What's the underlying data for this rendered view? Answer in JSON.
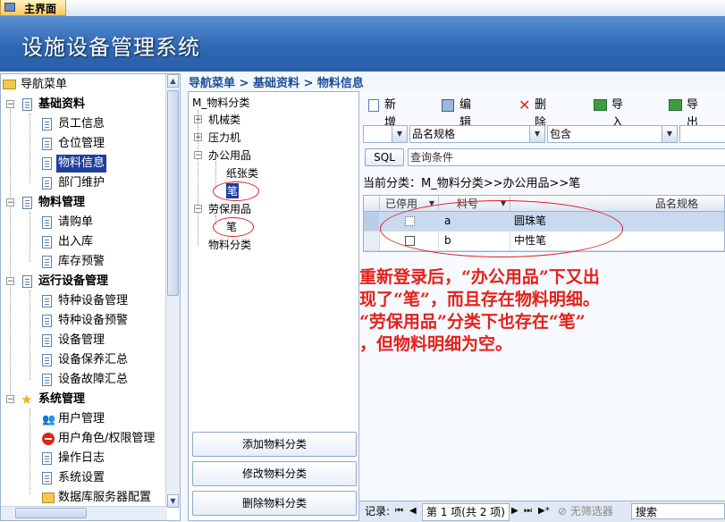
{
  "tab": {
    "label": "主界面"
  },
  "header": {
    "title": "设施设备管理系统"
  },
  "nav": {
    "root": "导航菜单",
    "groups": [
      {
        "label": "基础资料",
        "items": [
          "员工信息",
          "仓位管理",
          "物料信息",
          "部门维护"
        ]
      },
      {
        "label": "物料管理",
        "items": [
          "请购单",
          "出入库",
          "库存预警"
        ]
      },
      {
        "label": "运行设备管理",
        "items": [
          "特种设备管理",
          "特种设备预警",
          "设备管理",
          "设备保养汇总",
          "设备故障汇总"
        ]
      },
      {
        "label": "系统管理",
        "items": [
          "用户管理",
          "用户角色/权限管理",
          "操作日志",
          "系统设置",
          "数据库服务器配置"
        ]
      }
    ]
  },
  "breadcrumb": "导航菜单 > 基础资料 > 物料信息",
  "tree": {
    "root": "M_物料分类",
    "nodes": [
      "机械类",
      "压力机",
      "办公用品",
      "纸张类",
      "笔",
      "劳保用品",
      "笔",
      "物料分类"
    ]
  },
  "buttons": {
    "add": "添加物料分类",
    "edit": "修改物料分类",
    "del": "删除物料分类"
  },
  "toolbar": {
    "new": "新增",
    "edit": "编辑",
    "delete": "删除",
    "import": "导入",
    "export": "导出"
  },
  "filter": {
    "field": "品名规格",
    "op": "包含",
    "sql": "SQL",
    "query_placeholder": "查询条件"
  },
  "current_category": "当前分类：M_物料分类>>办公用品>>笔",
  "grid": {
    "headers": [
      "已停用",
      "料号",
      "品名规格"
    ],
    "rows": [
      {
        "code": "a",
        "name": "圆珠笔"
      },
      {
        "code": "b",
        "name": "中性笔"
      }
    ]
  },
  "annotation": {
    "lines": [
      "重新登录后，“办公用品”下又出",
      "现了“笔”，而且存在物料明细。",
      "“劳保用品”分类下也存在“笔”",
      "，但物料明细为空。"
    ],
    "color": "#e6201a"
  },
  "status": {
    "record_label": "记录:",
    "record_text": "第 1 项(共 2 项)",
    "filter_text": "无筛选器",
    "search_text": "搜索"
  }
}
